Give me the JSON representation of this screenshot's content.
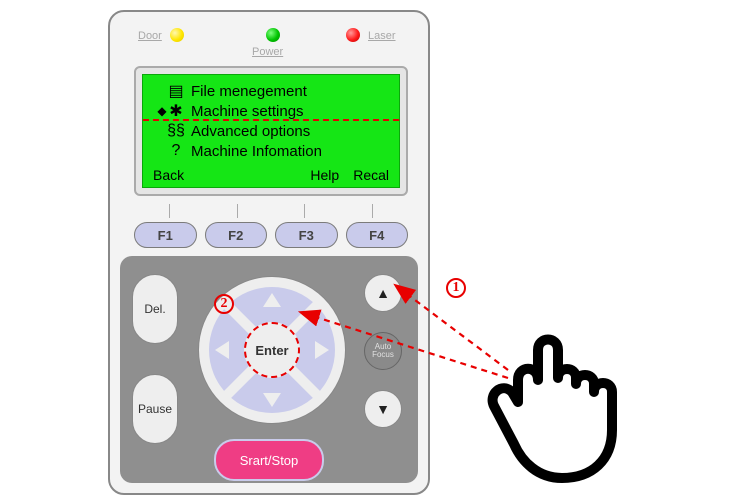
{
  "status": {
    "door_label": "Door",
    "power_label": "Power",
    "laser_label": "Laser"
  },
  "menu": {
    "items": [
      {
        "icon": "☰",
        "label": "File menegement"
      },
      {
        "icon": "✱",
        "label": "Machine settings"
      },
      {
        "icon": "§§",
        "label": "Advanced   options"
      },
      {
        "icon": "?",
        "label": "Machine Infomation"
      }
    ],
    "selected_index": 1,
    "selector_glyph": "◆"
  },
  "softkeys": {
    "back": "Back",
    "help": "Help",
    "recall": "Recal"
  },
  "fkeys": [
    "F1",
    "F2",
    "F3",
    "F4"
  ],
  "buttons": {
    "delete": "Del.",
    "pause": "Pause",
    "enter": "Enter",
    "auto_focus_line1": "Auto",
    "auto_focus_line2": "Focus",
    "start_stop": "Srart/Stop"
  },
  "arrows": {
    "up": "▲",
    "down": "▼"
  },
  "callouts": {
    "one": "1",
    "two": "2"
  },
  "colors": {
    "lcd": "#15e615",
    "keypad": "#c9cbeb",
    "panel": "#8f8f8f",
    "accent_red": "#e80000",
    "startstop": "#ef3d84"
  }
}
